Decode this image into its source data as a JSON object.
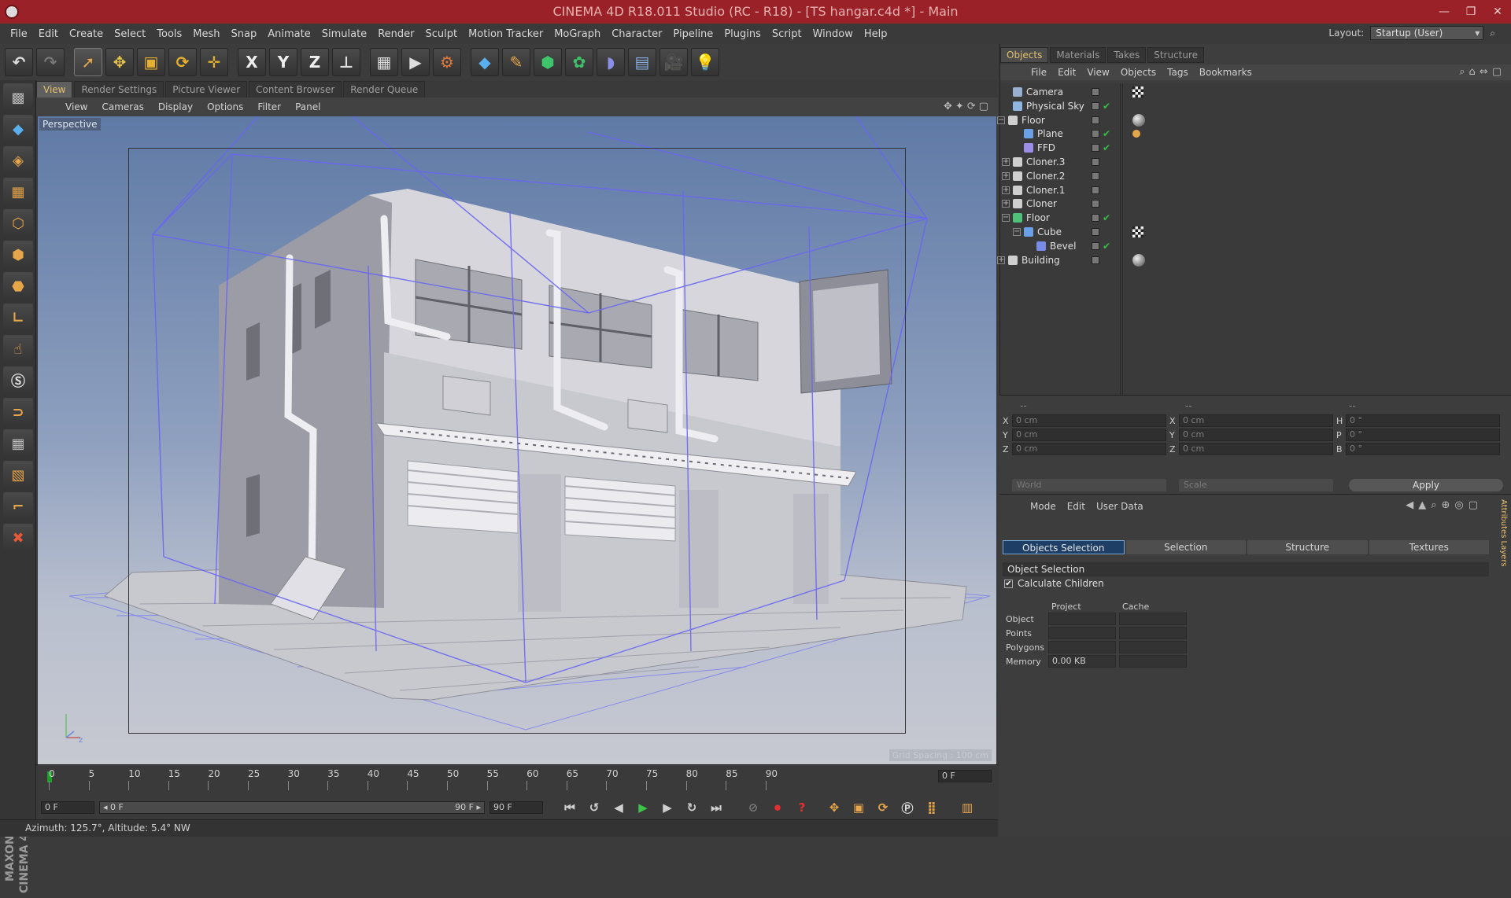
{
  "titlebar": {
    "title": "CINEMA 4D R18.011 Studio (RC - R18) - [TS hangar.c4d *] - Main",
    "minimize": "—",
    "maximize": "❐",
    "close": "✕"
  },
  "menu": [
    "File",
    "Edit",
    "Create",
    "Select",
    "Tools",
    "Mesh",
    "Snap",
    "Animate",
    "Simulate",
    "Render",
    "Sculpt",
    "Motion Tracker",
    "MoGraph",
    "Character",
    "Pipeline",
    "Plugins",
    "Script",
    "Window",
    "Help"
  ],
  "layout": {
    "label": "Layout:",
    "value": "Startup (User)"
  },
  "toolbar": {
    "icons": [
      "undo-icon",
      "redo-icon",
      "select-icon",
      "move-icon",
      "scale-icon",
      "rotate-icon",
      "live-select-icon",
      "x-axis-icon",
      "y-axis-icon",
      "z-axis-icon",
      "world-coord-icon",
      "render-view-icon",
      "render-picture-icon",
      "render-settings-icon",
      "cube-icon",
      "pen-icon",
      "subdivision-icon",
      "cloner-icon",
      "deformer-icon",
      "floor-icon",
      "camera-icon",
      "light-icon"
    ],
    "x": "X",
    "y": "Y",
    "z": "Z"
  },
  "viewport": {
    "tabs": [
      "View",
      "Render Settings",
      "Picture Viewer",
      "Content Browser",
      "Render Queue"
    ],
    "menu": [
      "View",
      "Cameras",
      "Display",
      "Options",
      "Filter",
      "Panel"
    ],
    "label": "Perspective",
    "grid_spacing": "Grid Spacing : 100 cm"
  },
  "timeline": {
    "ticks": [
      "0",
      "5",
      "10",
      "15",
      "20",
      "25",
      "30",
      "35",
      "40",
      "45",
      "50",
      "55",
      "60",
      "65",
      "70",
      "75",
      "80",
      "85",
      "90"
    ],
    "current_frame": "0 F"
  },
  "transport": {
    "start": "0 F",
    "range_start": "◂ 0 F",
    "range_end": "90 F ▸",
    "end": "90 F"
  },
  "status": {
    "text": "Azimuth: 125.7°, Altitude: 5.4°  NW"
  },
  "object_manager": {
    "tabs": [
      "Objects",
      "Materials",
      "Takes",
      "Structure"
    ],
    "menu": [
      "File",
      "Edit",
      "View",
      "Objects",
      "Tags",
      "Bookmarks"
    ],
    "objects": [
      {
        "name": "Camera",
        "color": "#9ab0d0"
      },
      {
        "name": "Physical Sky",
        "color": "#8fb6e0"
      },
      {
        "name": "Floor",
        "color": "#cfcfcf"
      },
      {
        "name": "Plane",
        "color": "#6aa0e8"
      },
      {
        "name": "FFD",
        "color": "#9c8ee6"
      },
      {
        "name": "Cloner.3",
        "color": "#cfcfcf"
      },
      {
        "name": "Cloner.2",
        "color": "#cfcfcf"
      },
      {
        "name": "Cloner.1",
        "color": "#cfcfcf"
      },
      {
        "name": "Cloner",
        "color": "#cfcfcf"
      },
      {
        "name": "Floor",
        "color": "#4fc27a"
      },
      {
        "name": "Cube",
        "color": "#6aa0e8"
      },
      {
        "name": "Bevel",
        "color": "#7a8ae8"
      },
      {
        "name": "Building",
        "color": "#cfcfcf"
      }
    ]
  },
  "coords": {
    "header": [
      "--",
      "--",
      "--"
    ],
    "rows": [
      {
        "a": "X",
        "av": "0 cm",
        "b": "X",
        "bv": "0 cm",
        "c": "H",
        "cv": "0 °"
      },
      {
        "a": "Y",
        "av": "0 cm",
        "b": "Y",
        "bv": "0 cm",
        "c": "P",
        "cv": "0 °"
      },
      {
        "a": "Z",
        "av": "0 cm",
        "b": "Z",
        "bv": "0 cm",
        "c": "B",
        "cv": "0 °"
      }
    ],
    "world": "World",
    "scale": "Scale",
    "apply": "Apply"
  },
  "attributes": {
    "menu": [
      "Mode",
      "Edit",
      "User Data"
    ],
    "tabs": [
      "Objects Selection",
      "Selection",
      "Structure",
      "Textures"
    ],
    "heading": "Object Selection",
    "calc_children": "Calculate Children",
    "cols": [
      "Project",
      "Cache"
    ],
    "rows": [
      {
        "label": "Object",
        "project": "",
        "cache": ""
      },
      {
        "label": "Points",
        "project": "",
        "cache": ""
      },
      {
        "label": "Polygons",
        "project": "",
        "cache": ""
      },
      {
        "label": "Memory",
        "project": "0.00 KB",
        "cache": ""
      }
    ],
    "side": "Attributes  Layers"
  }
}
